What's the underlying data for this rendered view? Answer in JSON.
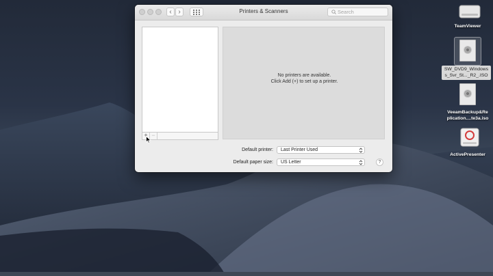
{
  "window": {
    "title": "Printers & Scanners",
    "search_placeholder": "Search",
    "nav_back": "‹",
    "nav_forward": "›",
    "add_button": "+",
    "remove_button": "−",
    "empty_message_line1": "No printers are available.",
    "empty_message_line2": "Click Add (+) to set up a printer.",
    "default_printer_label": "Default printer:",
    "default_printer_value": "Last Printer Used",
    "default_paper_label": "Default paper size:",
    "default_paper_value": "US Letter",
    "help_button": "?"
  },
  "desktop_icons": [
    {
      "name": "TeamViewer",
      "line1": "TeamViewer",
      "line2": ""
    },
    {
      "name": "SW_DVD9_Windows_Svr_St...R2_.ISO",
      "line1": "SW_DVD9_Windows",
      "line2": "s_Svr_St..._R2_.ISO"
    },
    {
      "name": "VeeamBackup&Replication....te3a.iso",
      "line1": "VeeamBackup&Re",
      "line2": "plication....te3a.iso"
    },
    {
      "name": "ActivePresenter",
      "line1": "ActivePresenter",
      "line2": ""
    }
  ],
  "colors": {
    "window_bg": "#ececec",
    "desktop": "#222a39",
    "activepresenter_red": "#d43c3c"
  }
}
